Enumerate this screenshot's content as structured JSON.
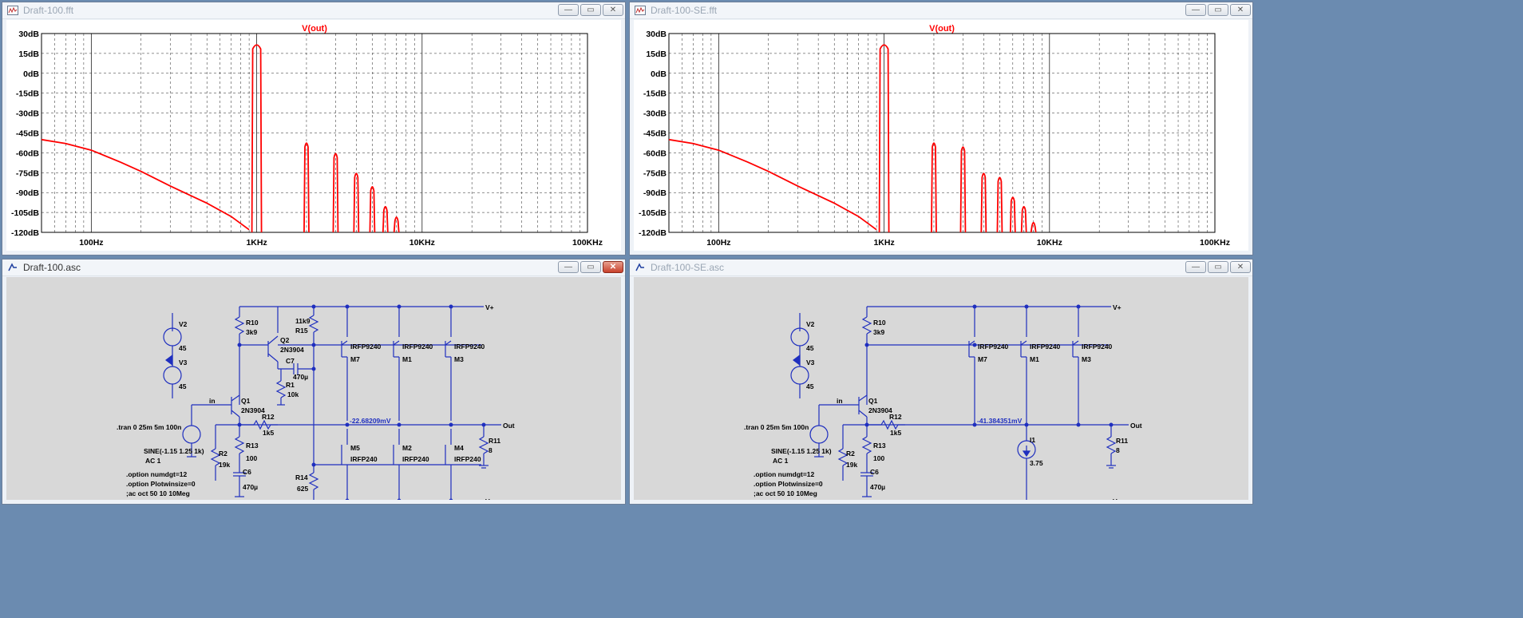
{
  "windows": {
    "fft1": {
      "title": "Draft-100.fft"
    },
    "fft2": {
      "title": "Draft-100-SE.fft"
    },
    "asc1": {
      "title": "Draft-100.asc"
    },
    "asc2": {
      "title": "Draft-100-SE.asc"
    }
  },
  "titlebar_buttons": {
    "minimize": "—",
    "maximize": "▭",
    "close": "✕"
  },
  "chart_data": [
    {
      "type": "line",
      "title": "V(out)",
      "x_scale": "log",
      "xlim": [
        50,
        100000
      ],
      "ylim": [
        -120,
        30
      ],
      "y_ticks": [
        "30dB",
        "15dB",
        "0dB",
        "-15dB",
        "-30dB",
        "-45dB",
        "-60dB",
        "-75dB",
        "-90dB",
        "-105dB",
        "-120dB"
      ],
      "x_ticks": [
        "100Hz",
        "1KHz",
        "10KHz",
        "100KHz"
      ],
      "grid": true,
      "color": "#ff0000",
      "noise_floor": [
        [
          50,
          -50
        ],
        [
          70,
          -53
        ],
        [
          100,
          -58
        ],
        [
          150,
          -67
        ],
        [
          200,
          -74
        ],
        [
          300,
          -85
        ],
        [
          500,
          -98
        ],
        [
          700,
          -108
        ],
        [
          900,
          -118
        ]
      ],
      "harmonics": [
        [
          1000,
          22
        ],
        [
          2000,
          -52
        ],
        [
          3000,
          -60
        ],
        [
          4000,
          -75
        ],
        [
          5000,
          -85
        ],
        [
          6000,
          -100
        ],
        [
          7000,
          -108
        ]
      ]
    },
    {
      "type": "line",
      "title": "V(out)",
      "x_scale": "log",
      "xlim": [
        50,
        100000
      ],
      "ylim": [
        -120,
        30
      ],
      "y_ticks": [
        "30dB",
        "15dB",
        "0dB",
        "-15dB",
        "-30dB",
        "-45dB",
        "-60dB",
        "-75dB",
        "-90dB",
        "-105dB",
        "-120dB"
      ],
      "x_ticks": [
        "100Hz",
        "1KHz",
        "10KHz",
        "100KHz"
      ],
      "grid": true,
      "color": "#ff0000",
      "noise_floor": [
        [
          50,
          -50
        ],
        [
          70,
          -53
        ],
        [
          100,
          -58
        ],
        [
          150,
          -67
        ],
        [
          200,
          -74
        ],
        [
          300,
          -85
        ],
        [
          500,
          -98
        ],
        [
          700,
          -108
        ],
        [
          900,
          -118
        ]
      ],
      "harmonics": [
        [
          1000,
          22
        ],
        [
          2000,
          -52
        ],
        [
          3000,
          -55
        ],
        [
          4000,
          -75
        ],
        [
          5000,
          -78
        ],
        [
          6000,
          -93
        ],
        [
          7000,
          -100
        ],
        [
          8000,
          -112
        ]
      ]
    }
  ],
  "schematic1": {
    "components": {
      "v2": "V2",
      "v2v": "45",
      "v3": "V3",
      "v3v": "45",
      "r10": "R10",
      "r10v": "3k9",
      "q2": "Q2",
      "q2m": "2N3904",
      "r15v": "11k9",
      "r15": "R15",
      "c7": "C7",
      "c7v": "470µ",
      "r1": "R1",
      "r1v": "10k",
      "q1": "Q1",
      "q1m": "2N3904",
      "in": "in",
      "r12": "R12",
      "r12v": "1k5",
      "r13": "R13",
      "r13v": "100",
      "c6": "C6",
      "c6v": "470µ",
      "r2": "R2",
      "r2v": "19k",
      "r14": "R14",
      "r14v": "625",
      "m7m": "IRFP9240",
      "m7": "M7",
      "m1m": "IRFP9240",
      "m1": "M1",
      "m3m": "IRFP9240",
      "m3": "M3",
      "m5": "M5",
      "m5m": "IRFP240",
      "m2": "M2",
      "m2m": "IRFP240",
      "m4": "M4",
      "m4m": "IRFP240",
      "r11": "R11",
      "r11v": "8",
      "vplus": "V+",
      "vminus": "V-",
      "out": "Out",
      "voltage": "-22.68209mV"
    },
    "directives": {
      "tran": ".tran 0 25m 5m 100n",
      "sine": "SINE(-1.15 1.25 1k)",
      "ac": "AC 1",
      "opt1": ".option numdgt=12",
      "opt2": ".option Plotwinsize=0",
      "opt3": ";ac oct 50 10 10Meg"
    }
  },
  "schematic2": {
    "components": {
      "v2": "V2",
      "v2v": "45",
      "v3": "V3",
      "v3v": "45",
      "r10": "R10",
      "r10v": "3k9",
      "q1": "Q1",
      "q1m": "2N3904",
      "in": "in",
      "r12": "R12",
      "r12v": "1k5",
      "r13": "R13",
      "r13v": "100",
      "c6": "C6",
      "c6v": "470µ",
      "r2": "R2",
      "r2v": "19k",
      "m7m": "IRFP9240",
      "m7": "M7",
      "m1m": "IRFP9240",
      "m1": "M1",
      "m3m": "IRFP9240",
      "m3": "M3",
      "i1": "I1",
      "i1v": "3.75",
      "r11": "R11",
      "r11v": "8",
      "vplus": "V+",
      "vminus": "V-",
      "out": "Out",
      "voltage": "-41.384351mV"
    },
    "directives": {
      "tran": ".tran 0 25m 5m 100n",
      "sine": "SINE(-1.15 1.25 1k)",
      "ac": "AC 1",
      "opt1": ".option numdgt=12",
      "opt2": ".option Plotwinsize=0",
      "opt3": ";ac oct 50 10 10Meg"
    }
  }
}
